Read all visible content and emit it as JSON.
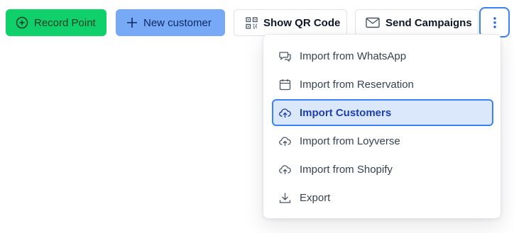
{
  "toolbar": {
    "record_point_label": "Record Point",
    "new_customer_label": "New customer",
    "show_qr_label": "Show QR Code",
    "send_campaigns_label": "Send Campaigns"
  },
  "menu": {
    "items": [
      {
        "label": "Import from WhatsApp",
        "icon": "chat-icon"
      },
      {
        "label": "Import from Reservation",
        "icon": "calendar-icon"
      },
      {
        "label": "Import Customers",
        "icon": "cloud-upload-icon",
        "active": true
      },
      {
        "label": "Import from Loyverse",
        "icon": "cloud-upload-icon"
      },
      {
        "label": "Import from Shopify",
        "icon": "cloud-upload-icon"
      },
      {
        "label": "Export",
        "icon": "download-icon"
      }
    ]
  },
  "colors": {
    "record_point_bg": "#10d06b",
    "new_customer_bg": "#77a9f6",
    "accent": "#3b82f6",
    "active_item_bg": "#dbe8fc"
  }
}
